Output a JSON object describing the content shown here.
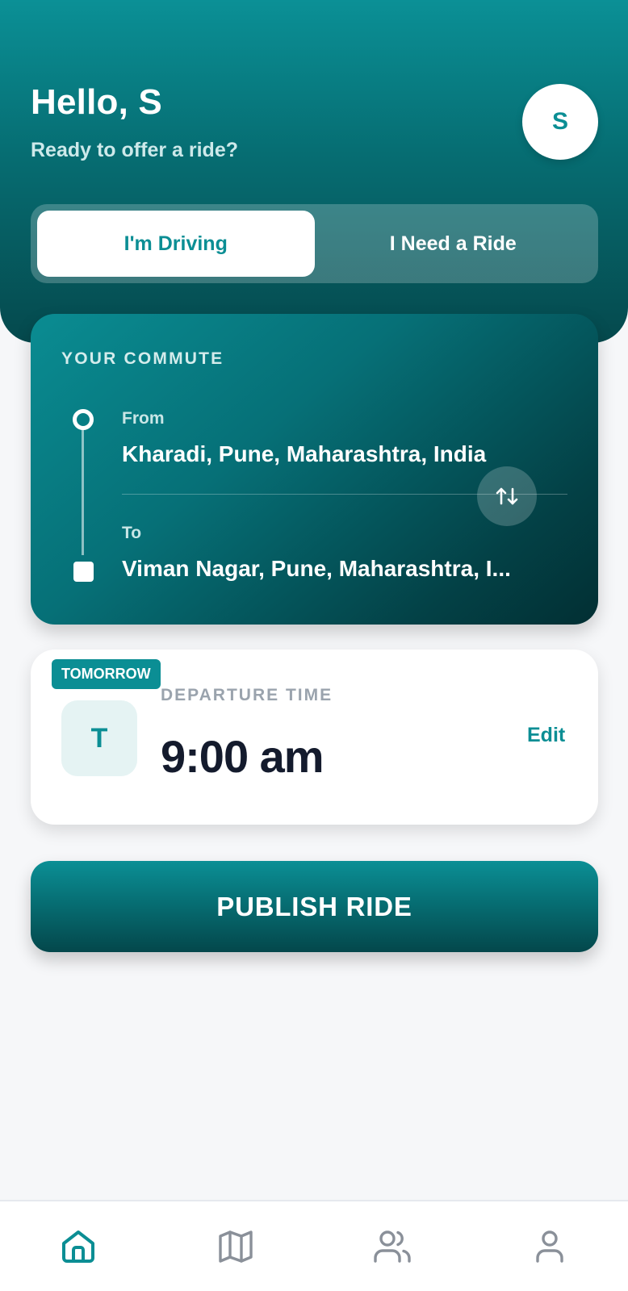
{
  "header": {
    "greeting": "Hello, S",
    "subtitle": "Ready to offer a ride?",
    "avatar_initial": "S"
  },
  "mode_toggle": {
    "options": [
      {
        "label": "I'm Driving",
        "active": true
      },
      {
        "label": "I Need a Ride",
        "active": false
      }
    ]
  },
  "commute": {
    "title": "YOUR COMMUTE",
    "from_label": "From",
    "from_value": "Kharadi, Pune, Maharashtra, India",
    "to_label": "To",
    "to_value": "Viman Nagar, Pune, Maharashtra, I..."
  },
  "departure": {
    "badge": "TOMORROW",
    "day_initial": "T",
    "label": "DEPARTURE TIME",
    "time": "9:00 am",
    "edit_label": "Edit"
  },
  "publish": {
    "label": "PUBLISH RIDE"
  },
  "bottom_nav": {
    "items": [
      {
        "icon": "home-icon",
        "active": true
      },
      {
        "icon": "map-icon",
        "active": false
      },
      {
        "icon": "users-icon",
        "active": false
      },
      {
        "icon": "profile-icon",
        "active": false
      }
    ]
  },
  "colors": {
    "accent": "#0b8e94",
    "dark_teal": "#034146",
    "inactive_icon": "#8a9099"
  }
}
